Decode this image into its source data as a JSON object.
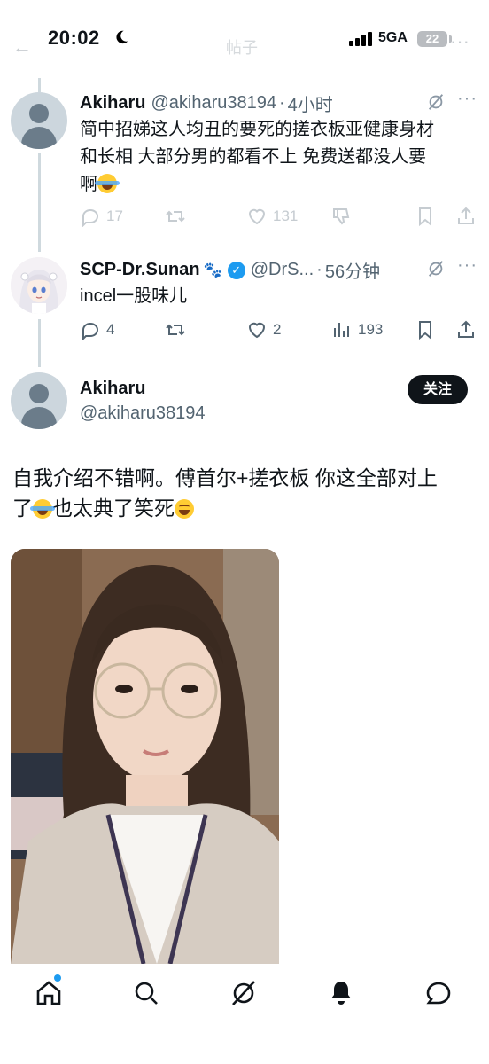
{
  "status_bar": {
    "time": "20:02",
    "network": "5GA",
    "battery": "22"
  },
  "header": {
    "faded_title": "帖子"
  },
  "tweets": [
    {
      "name": "Akiharu",
      "handle": "@akiharu38194",
      "time": "4小时",
      "text_line1": "简中招娣这人均丑的要死的搓衣板亚健康身材",
      "text_line2": "和长相 大部分男的都看不上 免费送都没人要",
      "text_line3": "啊",
      "replies": "17",
      "likes": "131"
    },
    {
      "name": "SCP-Dr.Sunan",
      "handle": "@DrS...",
      "time": "56分钟",
      "text": "incel一股味儿",
      "replies": "4",
      "likes": "2",
      "views": "193"
    }
  ],
  "main_tweet": {
    "name": "Akiharu",
    "handle": "@akiharu38194",
    "follow_label": "关注",
    "text_line1": "自我介绍不错啊。傅首尔+搓衣板 你这全部对上",
    "text_line2a": "了",
    "text_line2b": "也太典了笑死"
  },
  "icons": {
    "reply": "reply-icon",
    "retweet": "retweet-icon",
    "like": "heart-icon",
    "dislike": "thumbs-down-icon",
    "views": "views-icon",
    "bookmark": "bookmark-icon",
    "share": "share-icon",
    "grok": "grok-icon"
  },
  "colors": {
    "accent": "#1d9bf0",
    "text": "#0f1419",
    "secondary": "#536471",
    "faded": "#c6ccd1"
  }
}
